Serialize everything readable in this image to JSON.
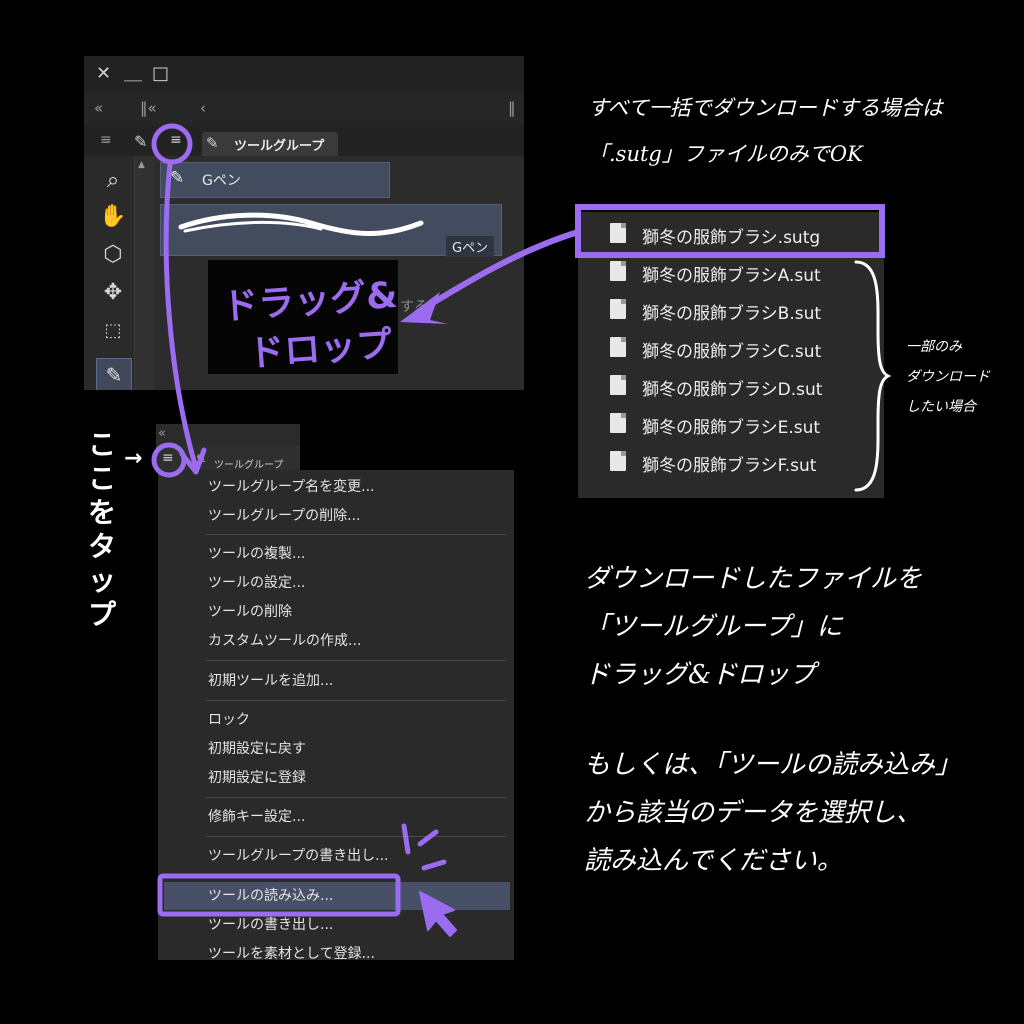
{
  "window": {
    "close_glyph": "✕",
    "minimize_glyph": "＿",
    "maximize_glyph": "□",
    "collapse_glyph": "«",
    "collapse2_glyph": "‖«",
    "back_glyph": "‹",
    "handle_glyph": "‖",
    "tab_label": "ツールグループ",
    "sub_tool": "Gペン",
    "brush_name": "Gペン",
    "drop_hint": "する",
    "drag_line1": "ドラッグ&",
    "drag_line2": "ドロップ"
  },
  "mini_panel": {
    "collapse_glyph": "«",
    "menu_glyph": "≡",
    "tab_label": "ツールグループ"
  },
  "menu": {
    "items": [
      "ツールグループ名を変更...",
      "ツールグループの削除...",
      "ツールの複製...",
      "ツールの設定...",
      "ツールの削除",
      "カスタムツールの作成...",
      "初期ツールを追加...",
      "ロック",
      "初期設定に戻す",
      "初期設定に登録",
      "修飾キー設定...",
      "ツールグループの書き出し...",
      "ツールの読み込み...",
      "ツールの書き出し...",
      "ツールを素材として登録..."
    ]
  },
  "files": [
    "獅冬の服飾ブラシ.sutg",
    "獅冬の服飾ブラシA.sut",
    "獅冬の服飾ブラシB.sut",
    "獅冬の服飾ブラシC.sut",
    "獅冬の服飾ブラシD.sut",
    "獅冬の服飾ブラシE.sut",
    "獅冬の服飾ブラシF.sut"
  ],
  "notes": {
    "top_line1": "すべて一括でダウンロードする場合は",
    "top_line2": "「.sutg」ファイルのみでOK",
    "side_line1": "一部のみ",
    "side_line2": "ダウンロード",
    "side_line3": "したい場合",
    "tap_arrow": "→",
    "tap_text": [
      "こ",
      "こ",
      "を",
      "タ",
      "ッ",
      "プ"
    ],
    "main_line1": "ダウンロードしたファイルを",
    "main_line2": "「ツールグループ」に",
    "main_line3": "ドラッグ&ドロップ",
    "main_line4": "もしくは、「ツールの読み込み」",
    "main_line5": "から該当のデータを選択し、",
    "main_line6": "読み込んでください。"
  },
  "colors": {
    "accent_purple": "#9b6cf0",
    "panel_dark": "#2a2a2a",
    "highlight_blue": "#485068"
  }
}
